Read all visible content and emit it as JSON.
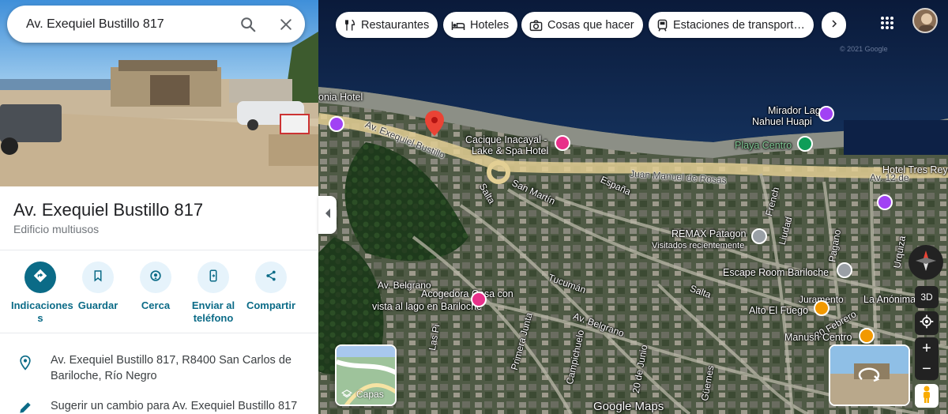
{
  "search": {
    "value": "Av. Exequiel Bustillo 817"
  },
  "place": {
    "title": "Av. Exequiel Bustillo 817",
    "category": "Edificio multiusos",
    "address": "Av. Exequiel Bustillo 817, R8400 San Carlos de Bariloche, Río Negro",
    "suggest_edit": "Sugerir un cambio para Av. Exequiel Bustillo 817"
  },
  "actions": [
    {
      "label": "Indicaciones",
      "label_line2": "s",
      "icon": "directions-icon"
    },
    {
      "label": "Guardar",
      "icon": "bookmark-icon"
    },
    {
      "label": "Cerca",
      "icon": "nearby-icon"
    },
    {
      "label": "Enviar al",
      "label_line2": "teléfono",
      "icon": "send-to-phone-icon"
    },
    {
      "label": "Compartir",
      "icon": "share-icon"
    }
  ],
  "chips": [
    {
      "label": "Restaurantes",
      "icon": "fork-knife-icon"
    },
    {
      "label": "Hoteles",
      "icon": "bed-icon"
    },
    {
      "label": "Cosas que hacer",
      "icon": "camera-icon"
    },
    {
      "label": "Estaciones de transport…",
      "icon": "train-icon"
    }
  ],
  "map_labels": {
    "onia_hotel": "onia Hotel",
    "cacique_1": "Cacique Inacayal -",
    "cacique_2": "Lake & Spa Hotel",
    "mirador_1": "Mirador Lago",
    "mirador_2": "Nahuel Huapi",
    "playa_centro": "Playa Centro",
    "hotel_tres_reyes": "Hotel Tres Reyes",
    "av_12_de": "Av. 12 de",
    "av_exequiel_bustillo": "Av. Exequiel Bustillo",
    "juan_manuel_de_rosas": "Juan Manuel de Rosas",
    "san_martin": "San Martín",
    "salta_1": "Salta",
    "espana": "España",
    "french": "French",
    "remax_1": "REMAX Patagon",
    "remax_2": "Visitados recientemente",
    "liudad": "Liudad",
    "pagano": "Pagano",
    "urquiza": "Urquiza",
    "tucuman_1": "Tucumán",
    "salta_2": "Salta",
    "escape_room": "Escape Room Bariloche",
    "av_belgrano_1": "Av. Belgrano",
    "acogedora_1": "Acogedora Casa con",
    "acogedora_2": "vista al lago en Bariloche",
    "las_pi": "Las Pi",
    "primero_vuelta": "Primera Junta",
    "av_belgrano_2": "Av. Belgrano",
    "campichuelo": "Campichuelo",
    "20_de_junio": "20 de Junio",
    "alto_el_fuego": "Alto El Fuego",
    "juramento": "Juramento",
    "20_febrero": "20 Febrero",
    "la_anonima": "La Anónima",
    "manush": "Manush Centro",
    "guemes": "Güemes",
    "google_maps": "Google Maps",
    "copyright": "© 2021 Google"
  },
  "controls": {
    "layers_label": "Capas",
    "three_d": "3D",
    "zoom_in": "+",
    "zoom_out": "−"
  },
  "colors": {
    "accent": "#0b6b87",
    "pin": "#ea4335",
    "poi_purple": "#a142f4",
    "poi_green": "#0f9d58",
    "poi_orange": "#f29900",
    "poi_gray": "#9aa0a6"
  }
}
